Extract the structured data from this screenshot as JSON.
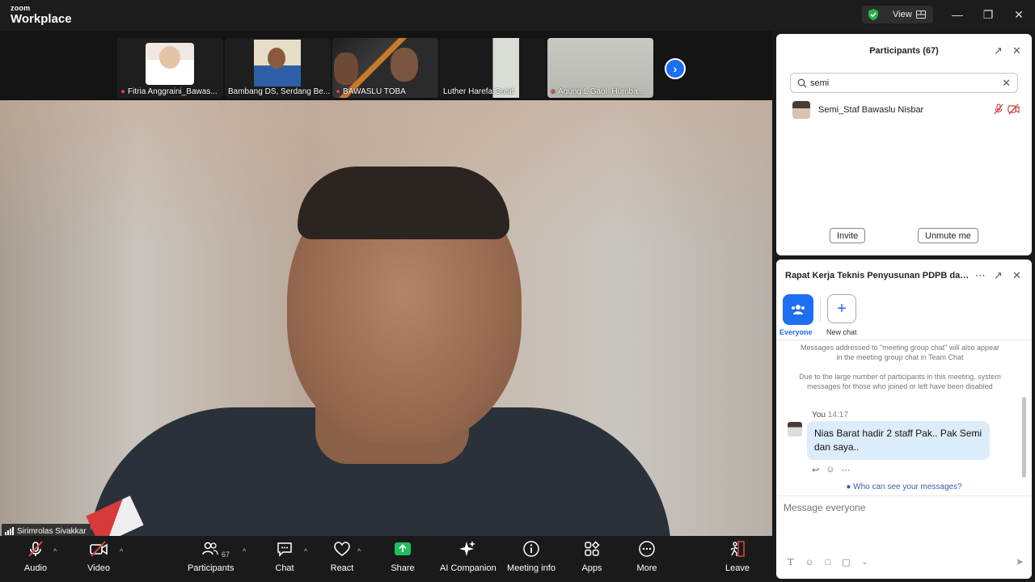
{
  "app": {
    "brand_small": "zoom",
    "brand_large": "Workplace",
    "view_label": "View"
  },
  "thumbnails": [
    {
      "name": "Fitria Anggraini_Bawas...",
      "muted": true
    },
    {
      "name": "Bambang DS, Serdang Be...",
      "muted": false
    },
    {
      "name": "BAWASLU TOBA",
      "muted": true
    },
    {
      "name": "Luther Harefa Gusit",
      "muted": false
    },
    {
      "name": "Agung L Gaol_Humba...",
      "muted": true
    }
  ],
  "main_video": {
    "speaker_name": "Sirimrolas Sivakkar"
  },
  "toolbar": {
    "audio": "Audio",
    "video": "Video",
    "participants": "Participants",
    "participants_count": "67",
    "chat": "Chat",
    "react": "React",
    "share": "Share",
    "ai_companion": "AI Companion",
    "meeting_info": "Meeting info",
    "apps": "Apps",
    "more": "More",
    "leave": "Leave"
  },
  "participants_panel": {
    "title": "Participants (67)",
    "search_value": "semi",
    "results": [
      {
        "name": "Semi_Staf Bawaslu Nisbar"
      }
    ],
    "invite_label": "Invite",
    "unmute_label": "Unmute me"
  },
  "chat_panel": {
    "title": "Rapat Kerja Teknis Penyusunan PDPB dan P...",
    "everyone_label": "Everyone",
    "new_chat_label": "New chat",
    "system_messages": [
      "Messages addressed to \"meeting group chat\" will also appear in the meeting group chat in Team Chat",
      "Due to the large number of participants in this meeting, system messages for those who joined or left have been disabled"
    ],
    "message": {
      "sender": "You",
      "time": "14:17",
      "text": "Nias Barat hadir 2 staff Pak.. Pak Semi dan saya.."
    },
    "who_can_see": "Who can see your messages?",
    "input_placeholder": "Message everyone"
  },
  "colors": {
    "accent": "#1c6ef2",
    "muted_red": "#e04444",
    "share_green": "#1fbf5b"
  }
}
